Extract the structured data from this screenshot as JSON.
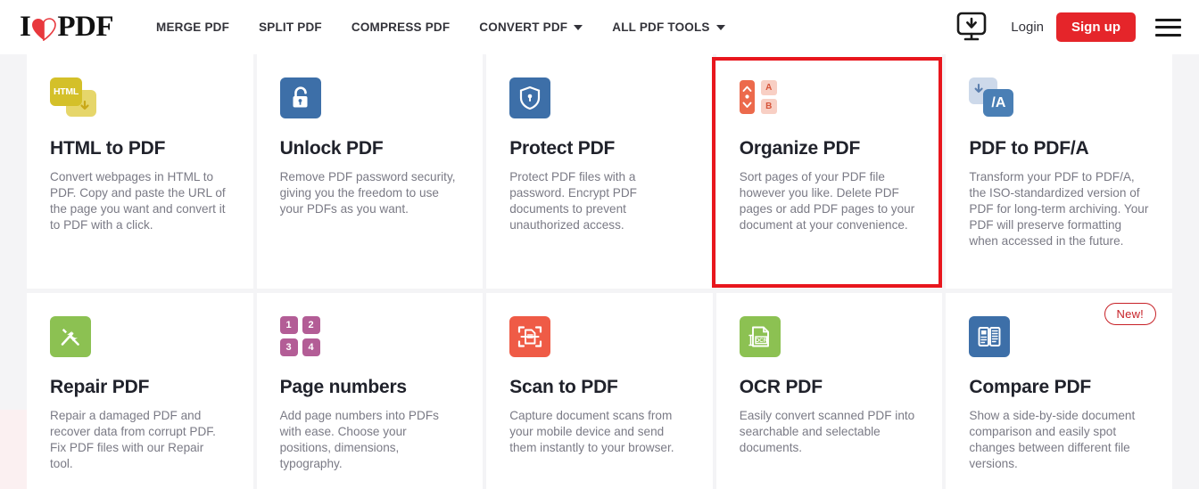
{
  "header": {
    "logo": {
      "text_before": "I",
      "icon": "heart-icon",
      "text_after": "PDF"
    },
    "nav": [
      {
        "label": "MERGE PDF",
        "has_caret": false,
        "name": "nav-merge-pdf"
      },
      {
        "label": "SPLIT PDF",
        "has_caret": false,
        "name": "nav-split-pdf"
      },
      {
        "label": "COMPRESS PDF",
        "has_caret": false,
        "name": "nav-compress-pdf"
      },
      {
        "label": "CONVERT PDF",
        "has_caret": true,
        "name": "nav-convert-pdf"
      },
      {
        "label": "ALL PDF TOOLS",
        "has_caret": true,
        "name": "nav-all-pdf-tools"
      }
    ],
    "desktop_download_icon": "desktop-download-icon",
    "login_label": "Login",
    "signup_label": "Sign up",
    "menu_icon": "hamburger-menu-icon",
    "accent_color": "#e5252a"
  },
  "highlight": {
    "target": "Organize PDF",
    "color": "#e8161d"
  },
  "tools": [
    {
      "title": "HTML to PDF",
      "desc": "Convert webpages in HTML to PDF. Copy and paste the URL of the page you want and convert it to PDF with a click.",
      "icon": "html-to-pdf-icon",
      "icon_label": "HTML",
      "color": "#d4c029",
      "badge": null
    },
    {
      "title": "Unlock PDF",
      "desc": "Remove PDF password security, giving you the freedom to use your PDFs as you want.",
      "icon": "unlock-padlock-icon",
      "icon_label": "",
      "color": "#3d6fa8",
      "badge": null
    },
    {
      "title": "Protect PDF",
      "desc": "Protect PDF files with a password. Encrypt PDF documents to prevent unauthorized access.",
      "icon": "shield-lock-icon",
      "icon_label": "",
      "color": "#3d6fa8",
      "badge": null
    },
    {
      "title": "Organize PDF",
      "desc": "Sort pages of your PDF file however you like. Delete PDF pages or add PDF pages to your document at your convenience.",
      "icon": "organize-pages-icon",
      "icon_label": "",
      "color": "#ec6a4c",
      "badge": null,
      "letters": [
        "A",
        "B"
      ]
    },
    {
      "title": "PDF to PDF/A",
      "desc": "Transform your PDF to PDF/A, the ISO-standardized version of PDF for long-term archiving. Your PDF will preserve formatting when accessed in the future.",
      "icon": "pdf-to-pdfa-icon",
      "icon_label": "/A",
      "color": "#4a7fb5",
      "badge": null
    },
    {
      "title": "Repair PDF",
      "desc": "Repair a damaged PDF and recover data from corrupt PDF. Fix PDF files with our Repair tool.",
      "icon": "repair-tools-icon",
      "icon_label": "",
      "color": "#8cc152",
      "badge": null
    },
    {
      "title": "Page numbers",
      "desc": "Add page numbers into PDFs with ease. Choose your positions, dimensions, typography.",
      "icon": "page-numbers-icon",
      "icon_label": "",
      "color": "#b35d96",
      "badge": null,
      "numbers": [
        "1",
        "2",
        "3",
        "4"
      ]
    },
    {
      "title": "Scan to PDF",
      "desc": "Capture document scans from your mobile device and send them instantly to your browser.",
      "icon": "scan-to-pdf-icon",
      "icon_label": "",
      "color": "#ef5b46",
      "badge": null
    },
    {
      "title": "OCR PDF",
      "desc": "Easily convert scanned PDF into searchable and selectable documents.",
      "icon": "ocr-pdf-icon",
      "icon_label": "OCR",
      "color": "#8cc152",
      "badge": null
    },
    {
      "title": "Compare PDF",
      "desc": "Show a side-by-side document comparison and easily spot changes between different file versions.",
      "icon": "compare-pdf-icon",
      "icon_label": "",
      "color": "#3d6fa8",
      "badge": "New!"
    }
  ]
}
